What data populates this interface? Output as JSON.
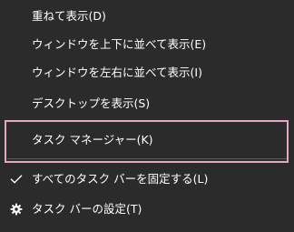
{
  "menu": {
    "items": [
      {
        "label": "重ねて表示(D)"
      },
      {
        "label": "ウィンドウを上下に並べて表示(E)"
      },
      {
        "label": "ウィンドウを左右に並べて表示(I)"
      },
      {
        "label": "デスクトップを表示(S)"
      },
      {
        "label": "タスク マネージャー(K)"
      },
      {
        "label": "すべてのタスク バーを固定する(L)",
        "icon": "checkmark-icon"
      },
      {
        "label": "タスク バーの設定(T)",
        "icon": "gear-icon"
      }
    ]
  },
  "colors": {
    "background": "#2b2b2b",
    "text": "#ffffff",
    "separator": "#5a5a5a",
    "highlight_border": "#e4a6c2"
  }
}
